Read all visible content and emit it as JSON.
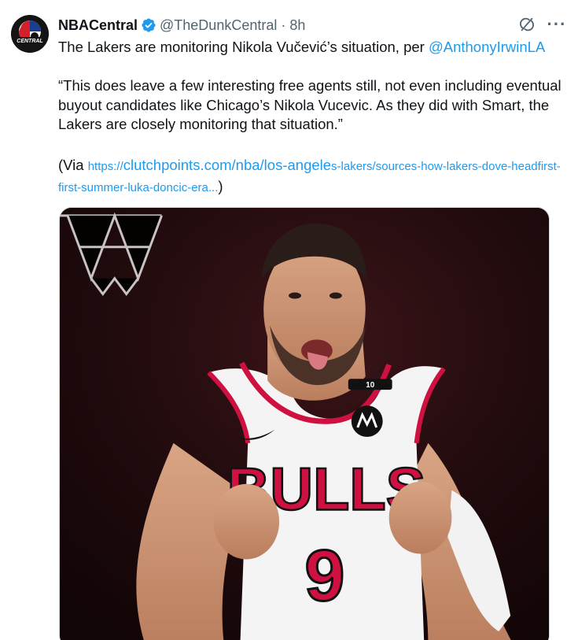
{
  "author": {
    "name": "NBACentral",
    "handle": "@TheDunkCentral",
    "separator": "·",
    "time": "8h",
    "avatar_text": "CENTRAL"
  },
  "tweet": {
    "line1_prefix": "The Lakers are monitoring Nikola Vučević’s situation, per ",
    "line1_mention": "@AnthonyIrwinLA",
    "quote": "“This does leave a few interesting free agents still, not even including eventual buyout candidates like Chicago’s Nikola Vucevic. As they did with Smart, the Lakers are closely monitoring that situation.”",
    "via_prefix": "(Via ",
    "link_scheme": "https://",
    "link_main": "clutchpoints.com/nba/los-angele",
    "link_rest": "s-lakers/sources-how-lakers-dove-headfirst-first-summer-luka-doncic-era...",
    "via_suffix": ")"
  },
  "media": {
    "jersey_word": "BULLS",
    "jersey_number": "9",
    "tag_number": "10"
  },
  "icons": {
    "verified": "verified-badge-icon",
    "grok": "grok-icon",
    "more": "more-icon"
  },
  "colors": {
    "link": "#1d9bf0",
    "secondary": "#536471",
    "bulls_red": "#ce1141"
  }
}
